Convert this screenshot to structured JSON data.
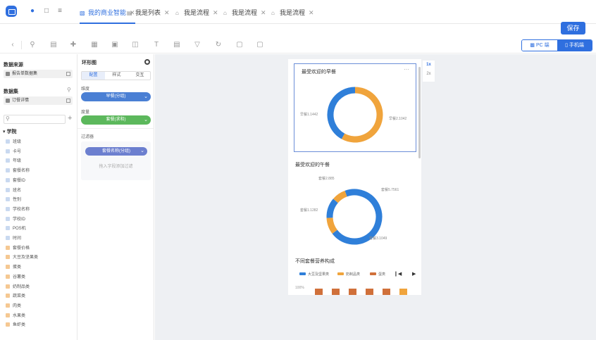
{
  "tabs": [
    {
      "label": "我的商业智能",
      "active": true
    },
    {
      "label": "我是列表",
      "active": false
    },
    {
      "label": "我是流程",
      "active": false
    },
    {
      "label": "我是流程",
      "active": false
    },
    {
      "label": "我是流程",
      "active": false
    }
  ],
  "save_label": "保存",
  "device_toggle": {
    "pc": "PC 端",
    "mobile": "手机端",
    "selected": "mobile"
  },
  "left_panel": {
    "data_source_title": "数据来源",
    "data_source_value": "报告单数据集",
    "dataset_title": "数据集",
    "dataset_value": "订餐详情",
    "search_placeholder": "",
    "group_title": "学院",
    "dimension_fields": [
      "班级",
      "卡号",
      "年级",
      "套餐名称",
      "套餐ID",
      "班名",
      "性别",
      "学校名称",
      "学校ID",
      "POS机",
      "时间"
    ],
    "measure_fields": [
      "套餐价格",
      "大豆及坚果类",
      "蛋类",
      "谷薯类",
      "奶制品类",
      "蔬菜类",
      "肉类",
      "水果类",
      "鱼虾类"
    ]
  },
  "mid_panel": {
    "title": "环形图",
    "subtabs": [
      "配置",
      "样式",
      "交互"
    ],
    "active_subtab": "配置",
    "dimension_label": "维度",
    "dimension_value": "早餐(分组)",
    "measure_label": "度量",
    "measure_value": "套餐(求和)",
    "filter_label": "过滤器",
    "filter_value": "套餐名称(分组)",
    "filter_hint": "拖入字段添加过滤"
  },
  "zoom": {
    "items": [
      "1x",
      "2x"
    ],
    "active": "1x"
  },
  "canvas": {
    "card1": {
      "title": "最受欢迎的早餐",
      "more": "···",
      "label_left": "早餐1.1442",
      "label_right": "早餐2.1042"
    },
    "card2": {
      "title": "最受欢迎的午餐",
      "label_top_left": "套餐2.885",
      "label_top_right": "套餐5.7561",
      "label_left": "套餐1.1282",
      "label_bottom_right": "套餐3.1049"
    },
    "card3": {
      "title": "不同套餐营养构成",
      "legend": [
        "大豆及坚果类",
        "奶制品类",
        "蛋类"
      ],
      "axis_label": "100%"
    }
  },
  "chart_data": [
    {
      "type": "pie",
      "title": "最受欢迎的早餐",
      "categories": [
        "早餐1",
        "早餐2"
      ],
      "values": [
        1442,
        1042
      ],
      "colors": [
        "#f0a43c",
        "#2f7fd9"
      ],
      "donut": true
    },
    {
      "type": "pie",
      "title": "最受欢迎的午餐",
      "categories": [
        "套餐5",
        "套餐3",
        "套餐1",
        "套餐2"
      ],
      "values": [
        7561,
        1049,
        1282,
        885
      ],
      "colors": [
        "#2f7fd9",
        "#f0a43c",
        "#2f7fd9",
        "#f0a43c"
      ],
      "donut": true
    }
  ],
  "colors": {
    "accent": "#2f6fdf",
    "blue": "#2f7fd9",
    "orange": "#f0a43c",
    "brown": "#d0703a"
  }
}
